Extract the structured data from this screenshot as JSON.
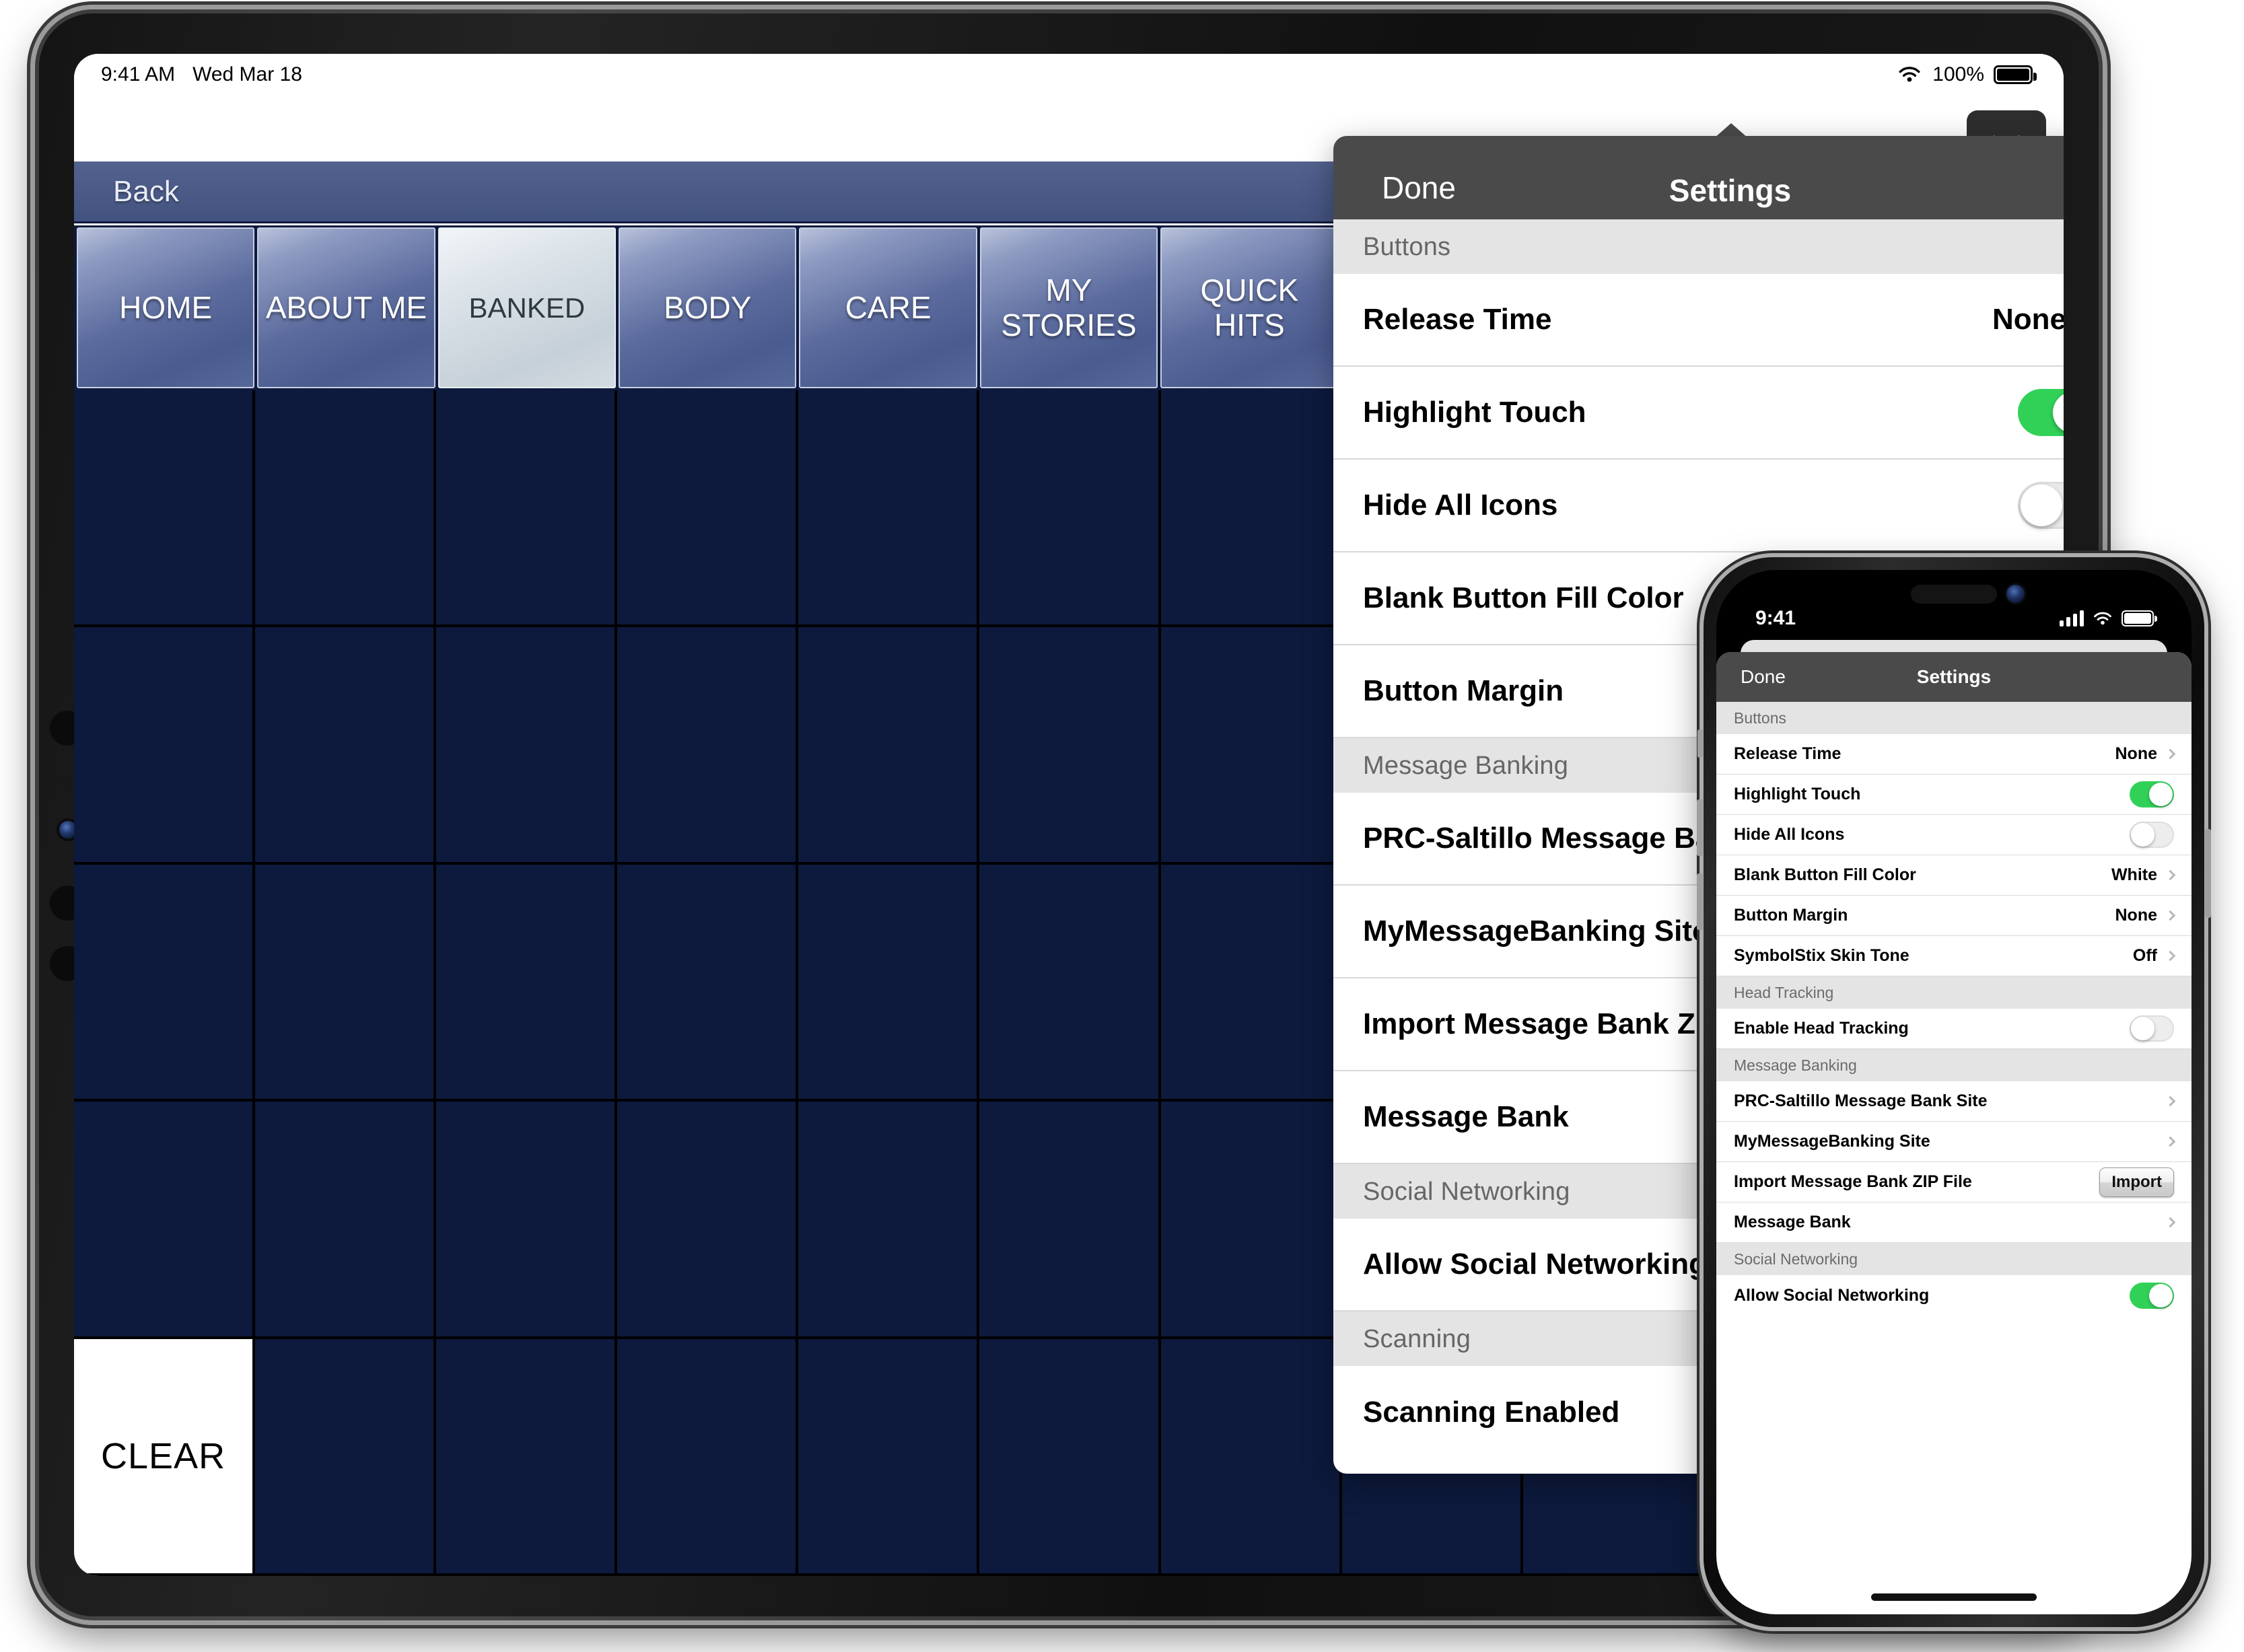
{
  "ipad": {
    "status_bar": {
      "time": "9:41 AM",
      "date": "Wed Mar 18",
      "battery_percent": "100%",
      "wifi_icon": "wifi-icon",
      "battery_icon": "battery-full-icon"
    },
    "app": {
      "close_label": "✕",
      "back_label": "Back",
      "nav_buttons": [
        {
          "label": "HOME",
          "state": "normal"
        },
        {
          "label": "ABOUT ME",
          "state": "normal"
        },
        {
          "label": "BANKED",
          "state": "selected"
        },
        {
          "label": "BODY",
          "state": "normal"
        },
        {
          "label": "CARE",
          "state": "normal"
        },
        {
          "label": "MY STORIES",
          "state": "normal"
        },
        {
          "label": "QUICK HITS",
          "state": "normal"
        },
        {
          "label": "",
          "state": "normal"
        },
        {
          "label": "",
          "state": "normal"
        },
        {
          "label": "",
          "state": "normal"
        },
        {
          "label": "",
          "state": "red"
        }
      ],
      "clear_label": "CLEAR",
      "grid_columns": 11,
      "grid_rows": 5
    },
    "popover": {
      "done_label": "Done",
      "title": "Settings",
      "sections": [
        {
          "header": "Buttons",
          "rows": [
            {
              "label": "Release Time",
              "type": "value",
              "value": "None"
            },
            {
              "label": "Highlight Touch",
              "type": "toggle",
              "value": "on"
            },
            {
              "label": "Hide All Icons",
              "type": "toggle",
              "value": "off"
            },
            {
              "label": "Blank Button Fill Color",
              "type": "value",
              "value": ""
            },
            {
              "label": "Button Margin",
              "type": "value",
              "value": ""
            }
          ]
        },
        {
          "header": "Message Banking",
          "rows": [
            {
              "label": "PRC-Saltillo Message Bank Site",
              "type": "disclosure",
              "value": ""
            },
            {
              "label": "MyMessageBanking Site",
              "type": "disclosure",
              "value": ""
            },
            {
              "label": "Import Message Bank ZIP File",
              "type": "disclosure",
              "value": ""
            },
            {
              "label": "Message Bank",
              "type": "disclosure",
              "value": ""
            }
          ]
        },
        {
          "header": "Social Networking",
          "rows": [
            {
              "label": "Allow Social Networking",
              "type": "toggle",
              "value": "on"
            }
          ]
        },
        {
          "header": "Scanning",
          "rows": [
            {
              "label": "Scanning Enabled",
              "type": "toggle",
              "value": "on"
            }
          ]
        }
      ]
    }
  },
  "iphone": {
    "status_bar": {
      "time": "9:41",
      "signal_icon": "cellular-signal-icon",
      "wifi_icon": "wifi-icon",
      "battery_icon": "battery-full-icon"
    },
    "popover": {
      "done_label": "Done",
      "title": "Settings",
      "sections": [
        {
          "header": "Buttons",
          "rows": [
            {
              "label": "Release Time",
              "type": "value",
              "value": "None"
            },
            {
              "label": "Highlight Touch",
              "type": "toggle",
              "value": "on"
            },
            {
              "label": "Hide All Icons",
              "type": "toggle",
              "value": "off"
            },
            {
              "label": "Blank Button Fill Color",
              "type": "value",
              "value": "White"
            },
            {
              "label": "Button Margin",
              "type": "value",
              "value": "None"
            },
            {
              "label": "SymbolStix Skin Tone",
              "type": "value",
              "value": "Off"
            }
          ]
        },
        {
          "header": "Head Tracking",
          "rows": [
            {
              "label": "Enable Head Tracking",
              "type": "toggle",
              "value": "off"
            }
          ]
        },
        {
          "header": "Message Banking",
          "rows": [
            {
              "label": "PRC-Saltillo Message Bank Site",
              "type": "disclosure",
              "value": ""
            },
            {
              "label": "MyMessageBanking Site",
              "type": "disclosure",
              "value": ""
            },
            {
              "label": "Import Message Bank ZIP File",
              "type": "button",
              "value": "Import"
            },
            {
              "label": "Message Bank",
              "type": "disclosure",
              "value": ""
            }
          ]
        },
        {
          "header": "Social Networking",
          "rows": [
            {
              "label": "Allow Social Networking",
              "type": "toggle",
              "value": "on"
            }
          ]
        }
      ]
    }
  },
  "colors": {
    "accent_green": "#31d158",
    "nav_blue": "#4a5b8f",
    "grid_navy": "#0d1a3d",
    "popover_header": "#4a4a4a",
    "red_button": "#8d1b20"
  }
}
